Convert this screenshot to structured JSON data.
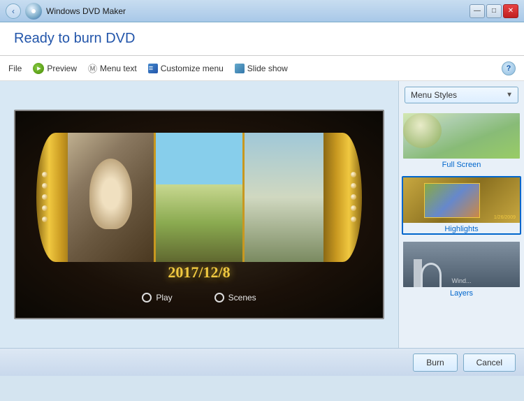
{
  "window": {
    "title": "Windows DVD Maker",
    "controls": {
      "minimize": "—",
      "maximize": "□",
      "close": "✕"
    }
  },
  "header": {
    "title": "Ready to burn DVD"
  },
  "toolbar": {
    "file_label": "File",
    "preview_label": "Preview",
    "menu_text_label": "Menu text",
    "customize_menu_label": "Customize menu",
    "slide_show_label": "Slide show",
    "help_label": "?"
  },
  "preview": {
    "date": "2017/12/8",
    "play_label": "Play",
    "scenes_label": "Scenes"
  },
  "right_panel": {
    "dropdown_label": "Menu Styles",
    "styles": [
      {
        "id": "full-screen",
        "label": "Full Screen",
        "selected": false
      },
      {
        "id": "highlights",
        "label": "Highlights",
        "selected": true
      },
      {
        "id": "layers",
        "label": "Layers",
        "selected": false
      }
    ]
  },
  "bottom": {
    "burn_label": "Burn",
    "cancel_label": "Cancel"
  }
}
